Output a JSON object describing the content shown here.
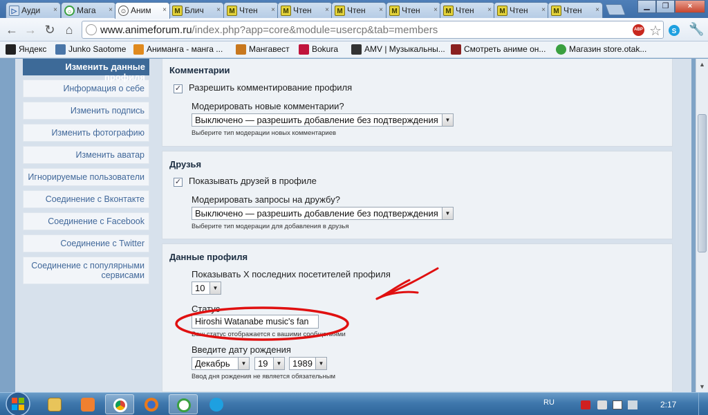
{
  "browser": {
    "tabs": [
      {
        "label": "Ауди",
        "icon": "play-icon"
      },
      {
        "label": "Мага",
        "icon": "circle-icon"
      },
      {
        "label": "Аним",
        "icon": "face-icon",
        "active": true
      },
      {
        "label": "Блич",
        "icon": "m-icon"
      },
      {
        "label": "Чтен",
        "icon": "m-icon"
      },
      {
        "label": "Чтен",
        "icon": "m-icon"
      },
      {
        "label": "Чтен",
        "icon": "m-icon"
      },
      {
        "label": "Чтен",
        "icon": "m-icon"
      },
      {
        "label": "Чтен",
        "icon": "m-icon"
      },
      {
        "label": "Чтен",
        "icon": "m-icon"
      },
      {
        "label": "Чтен",
        "icon": "m-icon"
      }
    ],
    "close_glyph": "×",
    "url_host": "www.animeforum.ru",
    "url_rest": "/index.php?app=core&module=usercp&tab=members",
    "abp_label": "ABP",
    "bookmarks": [
      {
        "label": "Яндекс",
        "icon": "yandex-icon",
        "color": "#222222"
      },
      {
        "label": "Junko Saotome",
        "icon": "vk-icon",
        "color": "#4a76a8"
      },
      {
        "label": "Анимангa - манга ...",
        "icon": "animanga-icon",
        "color": "#e08a1e"
      },
      {
        "label": "Мангавест",
        "icon": "mangavest-icon",
        "color": "#c8781e"
      },
      {
        "label": "Bokura",
        "icon": "bokura-icon",
        "color": "#c0143c"
      },
      {
        "label": "AMV | Музыкальны...",
        "icon": "amv-icon",
        "color": "#333333"
      },
      {
        "label": "Смотреть аниме он...",
        "icon": "anime-icon",
        "color": "#8a2020"
      },
      {
        "label": "Магазин store.otak...",
        "icon": "circle-icon",
        "color": "#3aa040"
      }
    ]
  },
  "sidebar": {
    "header": "Изменить данные профиля",
    "items": [
      "Информация о себе",
      "Изменить подпись",
      "Изменить фотографию",
      "Изменить аватар",
      "Игнорируемые пользователи",
      "Соединение с Вконтакте",
      "Соединение с Facebook",
      "Соединение с Twitter",
      "Соединение с популярными сервисами"
    ]
  },
  "comments": {
    "title": "Комментарии",
    "allow_label": "Разрешить комментирование профиля",
    "allow_checked": true,
    "moderate_label": "Модерировать новые комментарии?",
    "moderate_value": "Выключено — разрешить добавление без подтверждения",
    "moderate_hint": "Выберите тип модерации новых комментариев"
  },
  "friends": {
    "title": "Друзья",
    "show_label": "Показывать друзей в профиле",
    "show_checked": true,
    "moderate_label": "Модерировать запросы на дружбу?",
    "moderate_value": "Выключено — разрешить добавление без подтверждения",
    "moderate_hint": "Выберите тип модерации для добавления в друзья"
  },
  "profile": {
    "title": "Данные профиля",
    "visitors_label": "Показывать X последних посетителей профиля",
    "visitors_value": "10",
    "status_label": "Статус",
    "status_value": "Hiroshi Watanabe music's fan",
    "status_hint": "Ваш статус отображается с вашими сообщениями",
    "birthday_label": "Введите дату рождения",
    "birth_month": "Декабрь",
    "birth_day": "19",
    "birth_year": "1989",
    "birthday_hint": "Ввод дня рождения не является обязательным"
  },
  "annotation_color": "#e01010",
  "taskbar": {
    "lang": "RU",
    "time": "2:17"
  }
}
